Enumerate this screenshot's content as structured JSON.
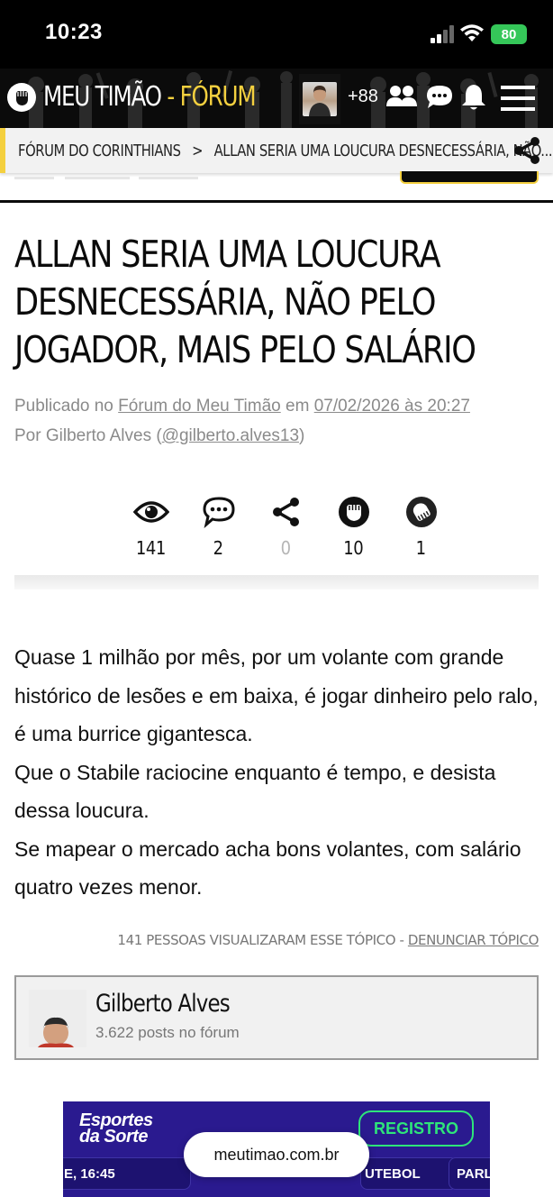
{
  "status_bar": {
    "time": "10:23",
    "battery": "80"
  },
  "header": {
    "logo_main": "MEU TIMÃO",
    "logo_sep": " - ",
    "logo_sub": "FÓRUM",
    "plus_count": "+88",
    "icons": [
      "users-icon",
      "chat-icon",
      "bell-icon",
      "menu-icon"
    ],
    "accent": "#f4d03f"
  },
  "breadcrumb": {
    "items": [
      "FÓRUM DO CORINTHIANS",
      ">",
      "ALLAN SERIA UMA LOUCURA DESNECESSÁRIA, NÃO..."
    ]
  },
  "post": {
    "title": "ALLAN SERIA UMA LOUCURA DESNECESSÁRIA, NÃO PELO JOGADOR, MAIS PELO SALÁRIO",
    "published_prefix": "Publicado no ",
    "forum_link": "Fórum do Meu Timão",
    "date_prefix": " em ",
    "date_link": "07/02/2026 às 20:27",
    "author_prefix": "Por Gilberto Alves (",
    "author_handle": "@gilberto.alves13",
    "author_suffix": ")",
    "stats": [
      {
        "icon": "eye-icon",
        "value": "141"
      },
      {
        "icon": "comment-icon",
        "value": "2"
      },
      {
        "icon": "share-icon",
        "value": "0"
      },
      {
        "icon": "fist-up-icon",
        "value": "10"
      },
      {
        "icon": "fist-down-icon",
        "value": "1"
      }
    ],
    "paragraphs": [
      "Quase 1 milhão por mês, por um volante com grande histórico de lesões e em baixa, é jogar dinheiro pelo ralo, é uma burrice gigantesca.",
      "Que o Stabile raciocine enquanto é tempo, e desista dessa loucura.",
      "Se mapear o mercado acha bons volantes, com salário quatro vezes menor."
    ],
    "views_text": "141 PESSOAS VISUALIZARAM ESSE TÓPICO - ",
    "report_link": "DENUNCIAR TÓPICO"
  },
  "author_card": {
    "name": "Gilberto Alves",
    "posts": "3.622 posts no fórum"
  },
  "ad": {
    "brand_line1": "Esportes",
    "brand_line2": "da Sorte",
    "register": "REGISTRO",
    "row1": "E, 16:45",
    "row2": "UTEBOL",
    "row3": "PARL"
  },
  "browser": {
    "url": "meutimao.com.br"
  }
}
